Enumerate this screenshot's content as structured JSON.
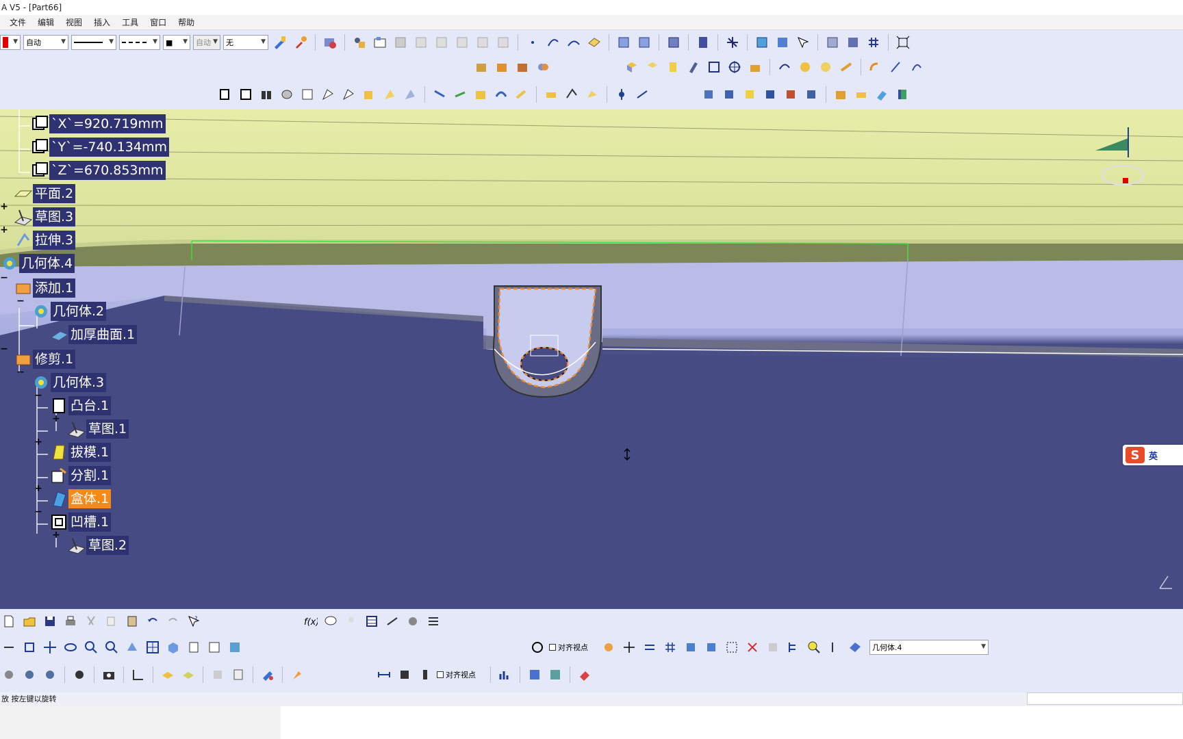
{
  "window": {
    "title": "A V5 - [Part66]"
  },
  "menu": [
    "文件",
    "编辑",
    "视图",
    "插入",
    "工具",
    "窗口",
    "帮助"
  ],
  "toolbar": {
    "color_combo": "",
    "layer_combo": "自动",
    "line_combo": "",
    "dash_combo": "",
    "point_combo": "■",
    "render_combo": "自动",
    "none_combo": "无",
    "align_checkbox_label": "对齐视点",
    "align_checkbox_label2": "对齐视点",
    "body_select": "几何体.4"
  },
  "tree": {
    "x_param": "`X`=920.719mm",
    "y_param": "`Y`=-740.134mm",
    "z_param": "`Z`=670.853mm",
    "plane2": "平面.2",
    "sketch3": "草图.3",
    "pad3": "拉伸.3",
    "body4": "几何体.4",
    "add1": "添加.1",
    "body2": "几何体.2",
    "thick1": "加厚曲面.1",
    "trim1": "修剪.1",
    "body3": "几何体.3",
    "boss1": "凸台.1",
    "sketch1": "草图.1",
    "draft1": "拔模.1",
    "split1": "分割.1",
    "shell1": "盒体.1",
    "pocket1": "凹槽.1",
    "sketch2": "草图.2"
  },
  "ime": {
    "label": "英"
  },
  "status": {
    "message": "放 按左键以旋转"
  },
  "colors": {
    "tree_label_bg": "#2f3270",
    "active_label_bg": "#f58a1a",
    "toolbar_bg": "#e4e8f8"
  }
}
